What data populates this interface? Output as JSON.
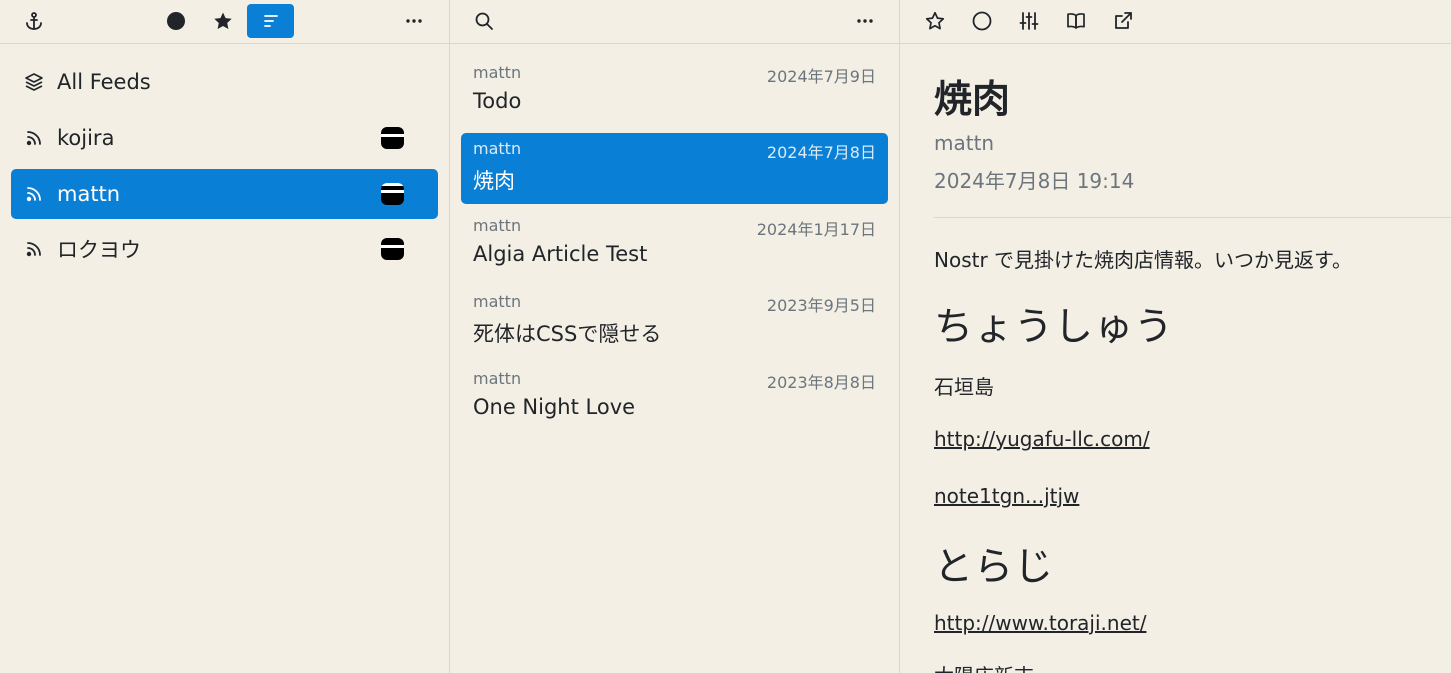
{
  "feeds": [
    {
      "label": "All Feeds",
      "icon": "layers-icon",
      "badge": false
    },
    {
      "label": "kojira",
      "icon": "rss-icon",
      "badge": true
    },
    {
      "label": "mattn",
      "icon": "rss-icon",
      "badge": true,
      "selected": true
    },
    {
      "label": "ロクヨウ",
      "icon": "rss-icon",
      "badge": true
    }
  ],
  "articles": [
    {
      "author": "mattn",
      "date": "2024年7月9日",
      "title": "Todo"
    },
    {
      "author": "mattn",
      "date": "2024年7月8日",
      "title": "焼肉",
      "selected": true
    },
    {
      "author": "mattn",
      "date": "2024年1月17日",
      "title": "Algia Article Test"
    },
    {
      "author": "mattn",
      "date": "2023年9月5日",
      "title": "死体はCSSで隠せる"
    },
    {
      "author": "mattn",
      "date": "2023年8月8日",
      "title": "One Night Love"
    }
  ],
  "reader": {
    "title": "焼肉",
    "author": "mattn",
    "date": "2024年7月8日 19:14",
    "content": [
      {
        "type": "p",
        "text": "Nostr で見掛けた焼肉店情報。いつか見返す。"
      },
      {
        "type": "h",
        "text": "ちょうしゅう"
      },
      {
        "type": "p",
        "text": "石垣島"
      },
      {
        "type": "link",
        "text": "http://yugafu-llc.com/"
      },
      {
        "type": "link",
        "text": "note1tgn...jtjw"
      },
      {
        "type": "h",
        "text": "とらじ"
      },
      {
        "type": "link",
        "text": "http://www.toraji.net/"
      },
      {
        "type": "p",
        "text": "太陽店新吉"
      }
    ]
  },
  "colors": {
    "accent": "#0a7fd6",
    "background": "#f3efe4",
    "muted": "#6c757d"
  }
}
